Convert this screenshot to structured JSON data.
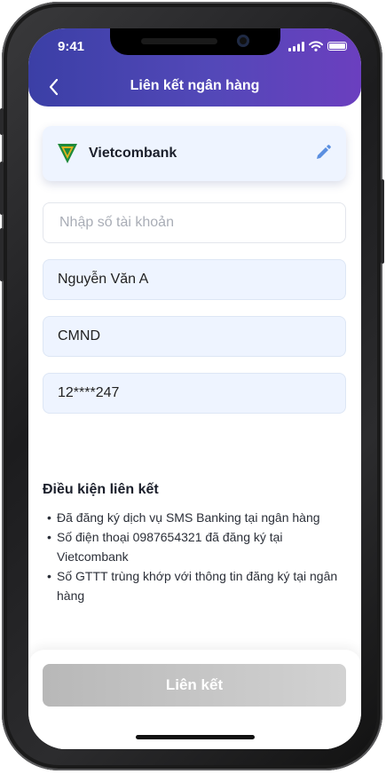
{
  "status": {
    "time": "9:41"
  },
  "header": {
    "title": "Liên kết ngân hàng"
  },
  "bank": {
    "name": "Vietcombank"
  },
  "form": {
    "account_placeholder": "Nhập số tài khoản",
    "account_value": "",
    "full_name": "Nguyễn Văn A",
    "id_type": "CMND",
    "id_number": "12****247"
  },
  "conditions": {
    "title": "Điều kiện liên kết",
    "items": [
      "Đã đăng ký dịch vụ SMS Banking tại ngân hàng",
      "Số điện thoại 0987654321 đã đăng ký tại Vietcombank",
      "Số GTTT trùng khớp với thông tin đăng ký tại ngân hàng"
    ]
  },
  "footer": {
    "submit_label": "Liên kết"
  },
  "colors": {
    "header_start": "#3b3fa6",
    "header_end": "#6b3fbf",
    "field_fill": "#eef4ff",
    "logo_green": "#1f8a3b",
    "logo_yellow": "#e0b21d",
    "edit_blue": "#5b8fe0",
    "disabled_button": "#c4c4c4"
  },
  "icons": {
    "back": "chevron-left-icon",
    "edit": "pencil-icon",
    "signal": "signal-icon",
    "wifi": "wifi-icon",
    "battery": "battery-icon",
    "bank_logo": "vietcombank-logo-icon"
  }
}
